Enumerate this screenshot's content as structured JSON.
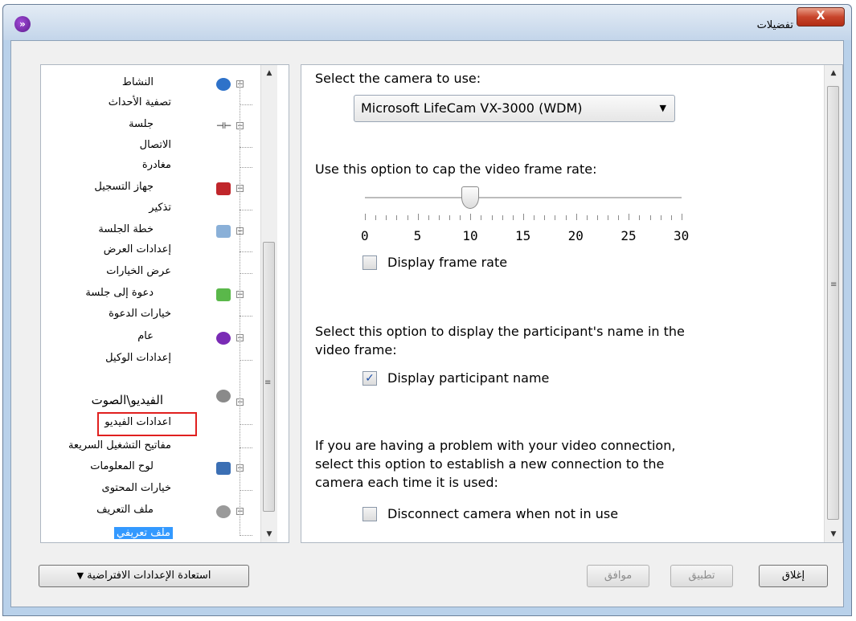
{
  "window": {
    "title": "تفضيلات",
    "close_label": "X"
  },
  "tree": {
    "items": [
      {
        "label": "النشاط",
        "icon": "chat-bubble-icon"
      },
      {
        "label": "تصفية الأحداث"
      },
      {
        "label": "جلسة",
        "icon": "connection-plug-icon"
      },
      {
        "label": "الاتصال"
      },
      {
        "label": "مغادرة"
      },
      {
        "label": "جهاز التسجيل",
        "icon": "recorder-icon"
      },
      {
        "label": "تذكير"
      },
      {
        "label": "خطة الجلسة",
        "icon": "clipboard-icon"
      },
      {
        "label": "إعدادات العرض"
      },
      {
        "label": "عرض الخيارات"
      },
      {
        "label": "دعوة إلى جلسة",
        "icon": "invite-people-icon"
      },
      {
        "label": "خيارات الدعوة"
      },
      {
        "label": "عام",
        "icon": "app-logo-icon"
      },
      {
        "label": "إعدادات الوكيل"
      },
      {
        "label": "الفيديو\\الصوت",
        "icon": "webcam-icon"
      },
      {
        "label": "اعدادات الفيديو"
      },
      {
        "label": "مفاتيح التشغيل السريعة"
      },
      {
        "label": "لوح المعلومات",
        "icon": "pen-icon"
      },
      {
        "label": "خيارات المحتوى"
      },
      {
        "label": "ملف التعريف",
        "icon": "profile-person-icon"
      },
      {
        "label": "ملف تعريفي"
      }
    ]
  },
  "video_settings": {
    "camera_label": "Select the camera to use:",
    "camera_value": "Microsoft LifeCam VX-3000 (WDM)",
    "cap_label": "Use this option to cap the video frame rate:",
    "slider_value": 10,
    "slider_min": 0,
    "slider_max": 30,
    "tick_labels": [
      "0",
      "5",
      "10",
      "15",
      "20",
      "25",
      "30"
    ],
    "display_frame_rate_label": "Display frame rate",
    "display_frame_rate_checked": false,
    "participant_text_1": "Select this option to display the participant's name in the",
    "participant_text_2": "video frame:",
    "display_participant_label": "Display participant name",
    "display_participant_checked": true,
    "problem_text_1": "If you are having a problem with your video connection,",
    "problem_text_2": "select this option to establish a new connection to the",
    "problem_text_3": "camera each time it is used:",
    "disconnect_label": "Disconnect camera when not in use",
    "disconnect_checked": false
  },
  "buttons": {
    "restore_defaults": "استعادة الإعدادات الافتراضية",
    "ok": "موافق",
    "apply": "تطبيق",
    "close": "إغلاق"
  },
  "colors": {
    "selection": "#3399ff",
    "highlight_border": "#e0201f",
    "titlebar": "#c3d5ea"
  }
}
